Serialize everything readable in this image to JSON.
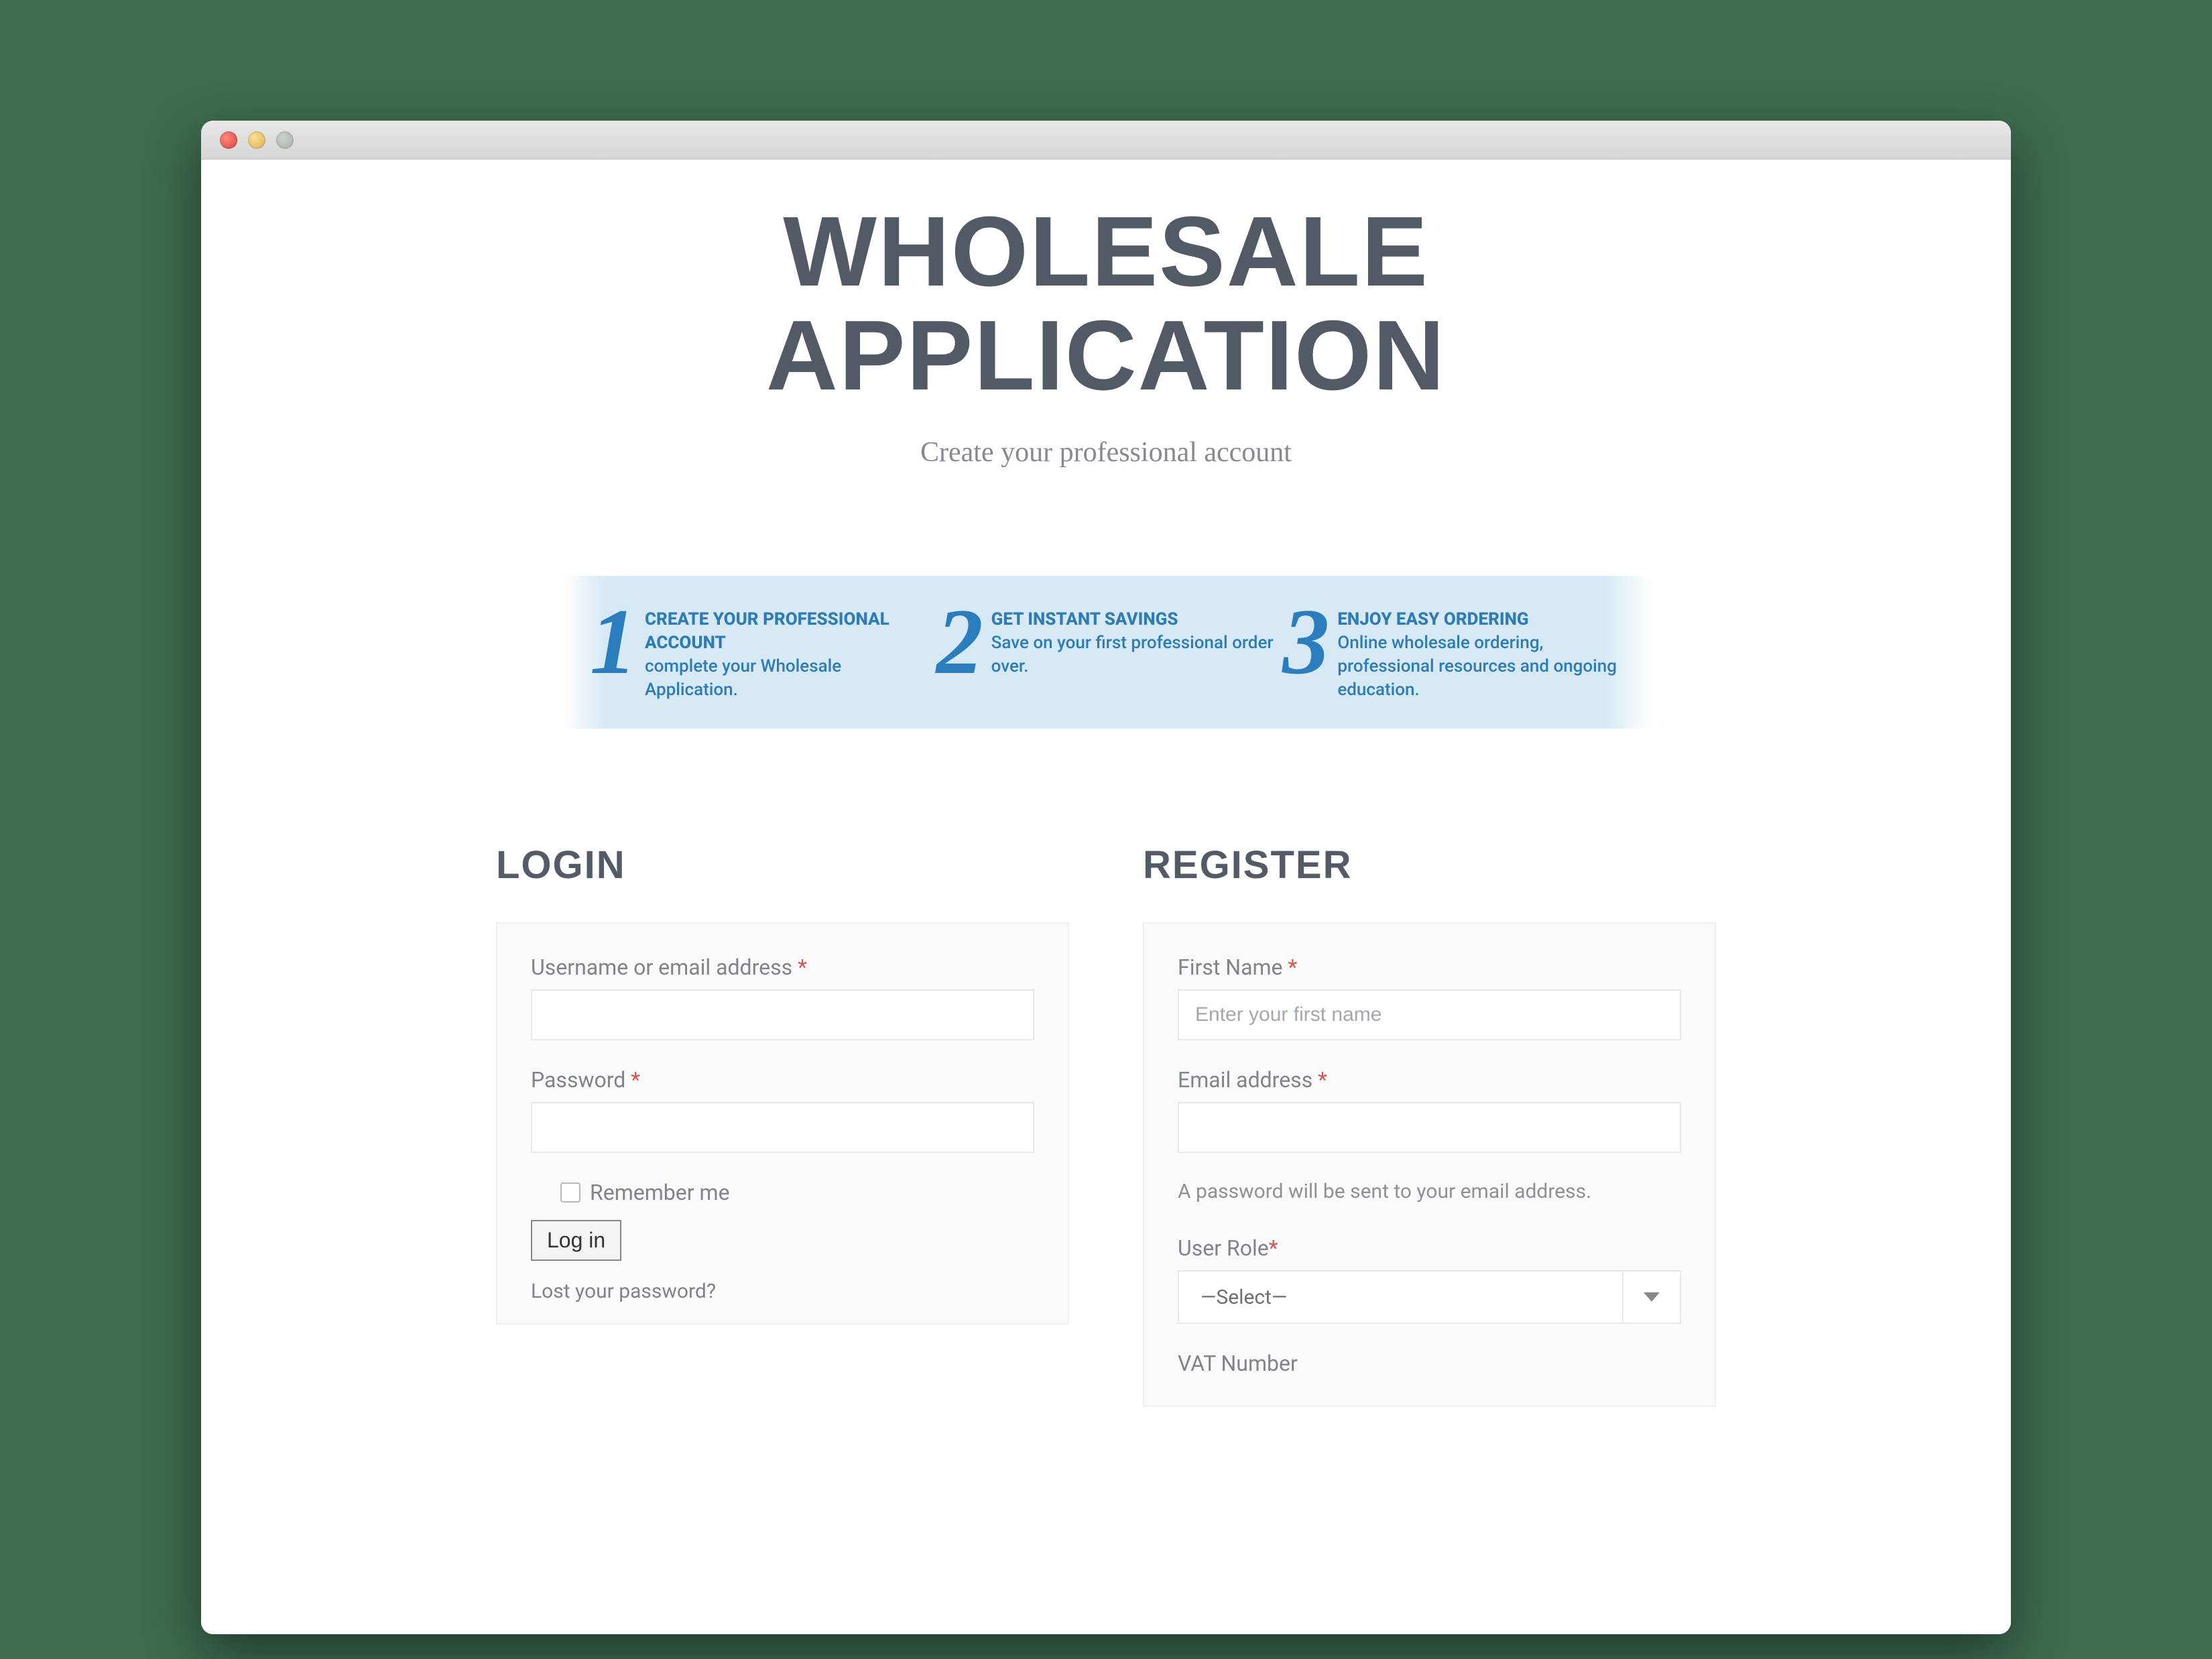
{
  "header": {
    "title_line1": "WHOLESALE",
    "title_line2": "APPLICATION",
    "subtitle": "Create your professional account"
  },
  "steps": [
    {
      "num": "1",
      "title": "CREATE YOUR PROFESSIONAL ACCOUNT",
      "body": "complete your Wholesale Application."
    },
    {
      "num": "2",
      "title": "GET INSTANT SAVINGS",
      "body": "Save on your first professional order over."
    },
    {
      "num": "3",
      "title": "ENJOY EASY ORDERING",
      "body": "Online wholesale ordering, professional resources and ongoing education."
    }
  ],
  "login": {
    "heading": "LOGIN",
    "username_label": "Username or email address",
    "password_label": "Password",
    "remember_label": "Remember me",
    "button_label": "Log in",
    "lost_link": "Lost your password?"
  },
  "register": {
    "heading": "REGISTER",
    "firstname_label": "First Name",
    "firstname_placeholder": "Enter your first name",
    "email_label": "Email address",
    "password_note": "A password will be sent to your email address.",
    "role_label": "User Role",
    "role_selected": "—Select—",
    "vat_label": "VAT Number"
  },
  "required_marker": "*"
}
